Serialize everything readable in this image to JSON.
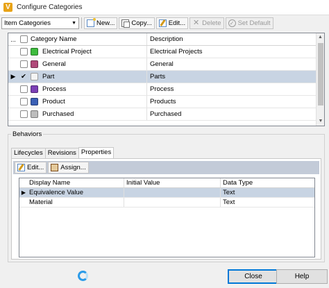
{
  "window": {
    "title": "Configure Categories",
    "logo_letter": "V"
  },
  "toolbar": {
    "dropdown_value": "Item Categories",
    "buttons": {
      "new": "New...",
      "copy": "Copy...",
      "edit": "Edit...",
      "delete": "Delete",
      "set_default": "Set Default"
    }
  },
  "categories": {
    "header": {
      "indicator": "...",
      "name": "Category Name",
      "description": "Description"
    },
    "rows": [
      {
        "name": "Electrical Project",
        "description": "Electrical Projects",
        "color": "#3dbb3d",
        "selected": false
      },
      {
        "name": "General",
        "description": "General",
        "color": "#b04a7a",
        "selected": false
      },
      {
        "name": "Part",
        "description": "Parts",
        "color": "#f4f4f4",
        "selected": true,
        "indicator": "▶",
        "check": "✔"
      },
      {
        "name": "Process",
        "description": "Process",
        "color": "#7b3fb5",
        "selected": false
      },
      {
        "name": "Product",
        "description": "Products",
        "color": "#3a5fb5",
        "selected": false
      },
      {
        "name": "Purchased",
        "description": "Purchased",
        "color": "#bdbdbd",
        "selected": false
      }
    ]
  },
  "behaviors": {
    "label": "Behaviors",
    "tabs": [
      "Lifecycles",
      "Revisions",
      "Properties"
    ],
    "active_tab": "Properties",
    "toolbar": {
      "edit": "Edit...",
      "assign": "Assign..."
    },
    "grid": {
      "headers": {
        "display_name": "Display Name",
        "initial_value": "Initial Value",
        "data_type": "Data Type"
      },
      "rows": [
        {
          "display_name": "Equivalence Value",
          "initial_value": "",
          "data_type": "Text",
          "selected": true,
          "indicator": "▶"
        },
        {
          "display_name": "Material",
          "initial_value": "",
          "data_type": "Text",
          "selected": false,
          "indicator": ""
        }
      ]
    }
  },
  "footer": {
    "close": "Close",
    "help": "Help"
  }
}
